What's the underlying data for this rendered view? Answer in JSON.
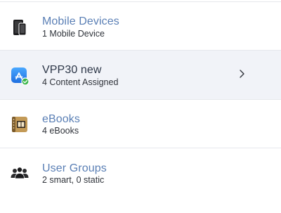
{
  "colors": {
    "link_title": "#5a7fb5",
    "selected_title": "#2d3748",
    "selected_background": "#f1f3f8",
    "divider": "#e6e8ec",
    "subtitle": "#2f333a",
    "check_badge": "#3ab54a",
    "app_store_blue": "#2d8cf0"
  },
  "items": [
    {
      "title": "Mobile Devices",
      "subtitle": "1 Mobile Device",
      "icon": "mobile-devices-icon",
      "selected": false
    },
    {
      "title": "VPP30 new",
      "subtitle": "4 Content Assigned",
      "icon": "app-store-icon",
      "selected": true,
      "chevron_icon": "chevron-right-icon"
    },
    {
      "title": "eBooks",
      "subtitle": "4 eBooks",
      "icon": "ebooks-icon",
      "selected": false
    },
    {
      "title": "User Groups",
      "subtitle": "2 smart, 0 static",
      "icon": "user-groups-icon",
      "selected": false
    }
  ]
}
